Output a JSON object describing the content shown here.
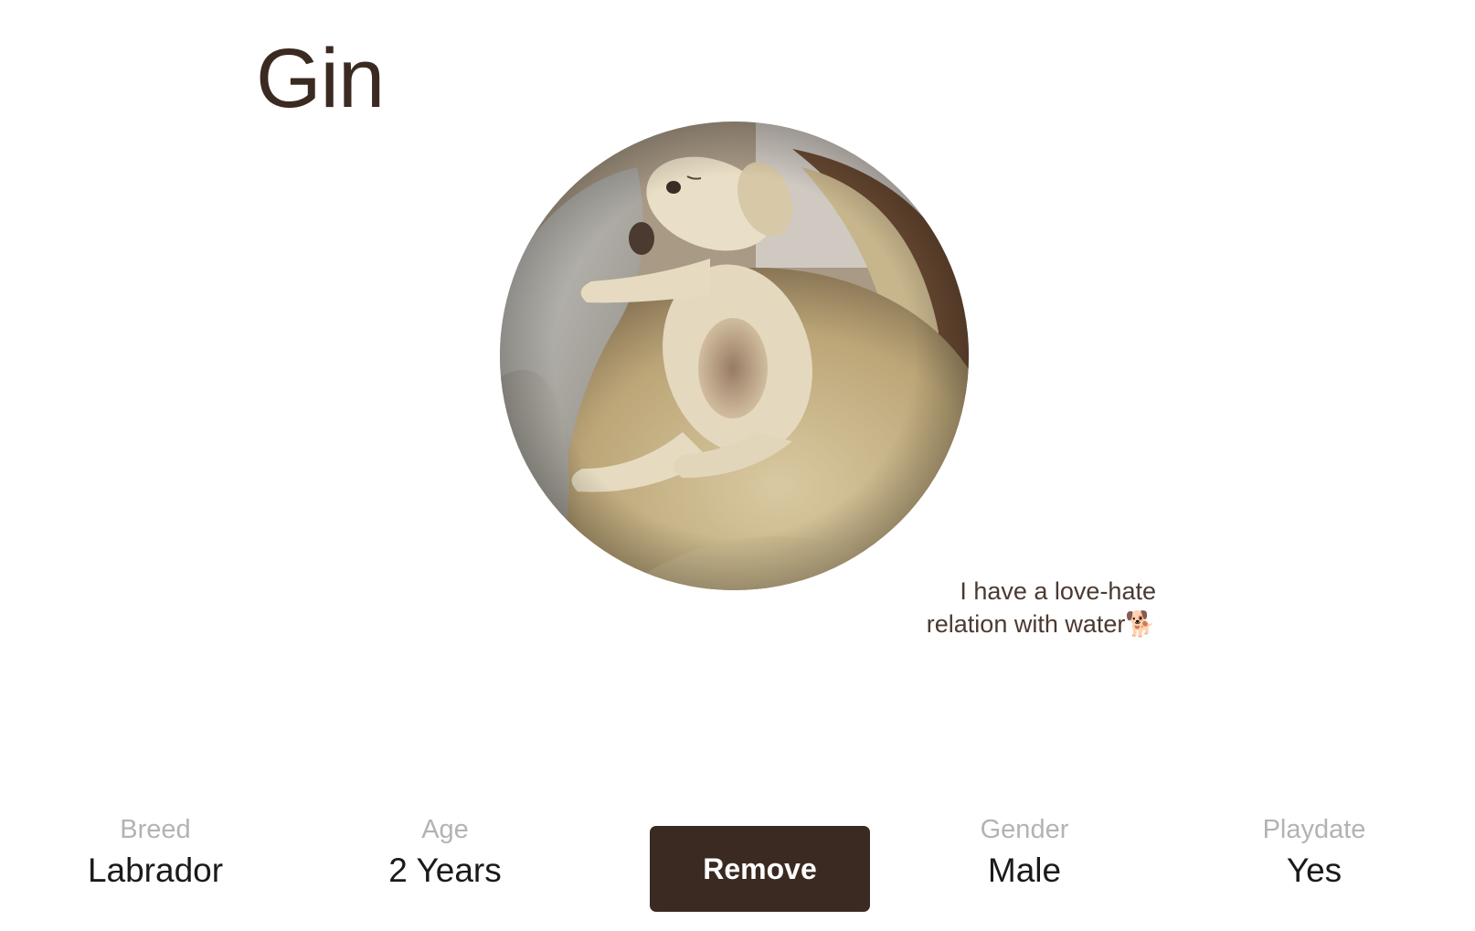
{
  "pet": {
    "name": "Gin",
    "bio": "I have a love-hate relation with water🐕",
    "photo_subject": "sleeping puppy in pet bed"
  },
  "stats": [
    {
      "label": "Breed",
      "value": "Labrador"
    },
    {
      "label": "Age",
      "value": "2 Years"
    },
    {
      "label": "Gender",
      "value": "Male"
    },
    {
      "label": "Playdate",
      "value": "Yes"
    }
  ],
  "actions": {
    "remove_label": "Remove"
  },
  "colors": {
    "brand_dark": "#3b2a22",
    "label_gray": "#b3b3b3"
  }
}
